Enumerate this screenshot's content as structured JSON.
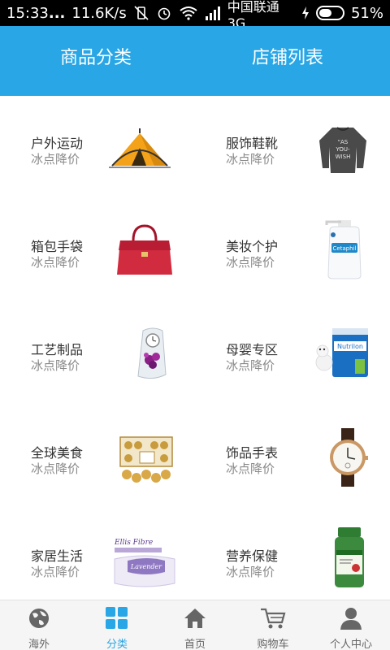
{
  "status_bar": {
    "time": "15:33",
    "dots": "...",
    "speed": "11.6K/s",
    "carrier": "中国联通 3G",
    "battery_pct": "51%",
    "battery_level": 0.51
  },
  "header": {
    "tab_category": "商品分类",
    "tab_shops": "店铺列表",
    "active_tab": "商品分类",
    "bg_color": "#29a6e5"
  },
  "categories": [
    {
      "name": "户外运动",
      "sub": "冰点降价",
      "image": "tent-image"
    },
    {
      "name": "服饰鞋靴",
      "sub": "冰点降价",
      "image": "sweater-image"
    },
    {
      "name": "箱包手袋",
      "sub": "冰点降价",
      "image": "handbag-image"
    },
    {
      "name": "美妆个护",
      "sub": "冰点降价",
      "image": "lotion-bottle-image"
    },
    {
      "name": "工艺制品",
      "sub": "冰点降价",
      "image": "crystal-clock-image"
    },
    {
      "name": "母婴专区",
      "sub": "冰点降价",
      "image": "milk-formula-image"
    },
    {
      "name": "全球美食",
      "sub": "冰点降价",
      "image": "chocolate-box-image"
    },
    {
      "name": "饰品手表",
      "sub": "冰点降价",
      "image": "watch-image"
    },
    {
      "name": "家居生活",
      "sub": "冰点降价",
      "image": "pillow-image"
    },
    {
      "name": "营养保健",
      "sub": "冰点降价",
      "image": "supplement-bottle-image"
    }
  ],
  "bottom_nav": [
    {
      "label": "海外",
      "icon": "globe-icon"
    },
    {
      "label": "分类",
      "icon": "grid-icon",
      "active": true
    },
    {
      "label": "首页",
      "icon": "home-icon"
    },
    {
      "label": "购物车",
      "icon": "cart-icon"
    },
    {
      "label": "个人中心",
      "icon": "person-icon"
    }
  ],
  "pillow_label_top": "Ellis Fibre",
  "pillow_label_brand": "Lavender",
  "formula_brand": "Nutrilon",
  "lotion_brand": "Cetaphil",
  "sweater_text": "AS YOU WISH"
}
